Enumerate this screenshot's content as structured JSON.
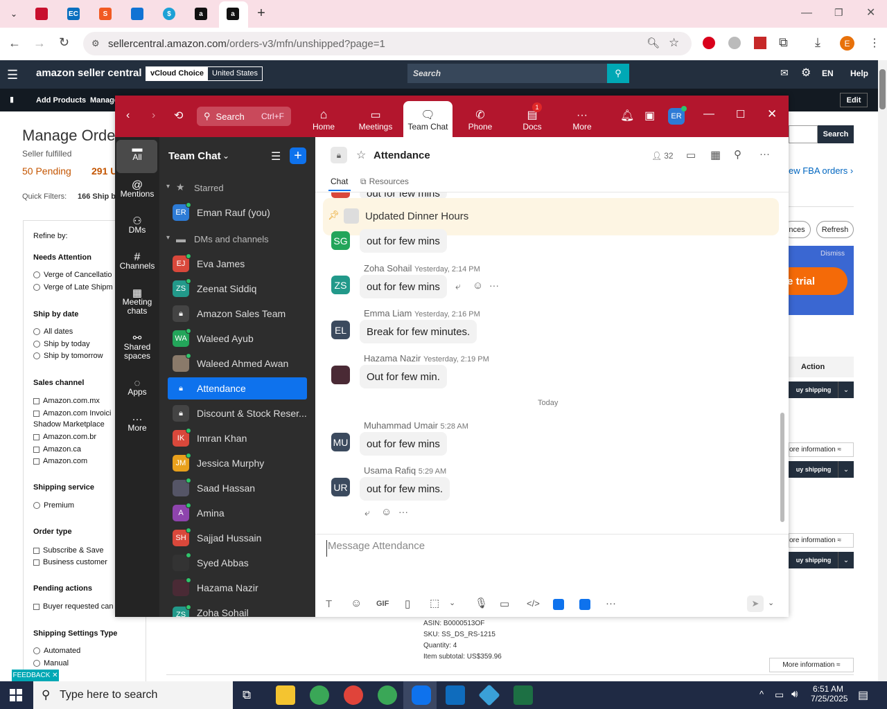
{
  "browser": {
    "url_domain": "sellercentral.amazon.com",
    "url_path": "/orders-v3/mfn/unshipped?page=1",
    "profile_initial": "E"
  },
  "seller_central": {
    "logo": "amazon seller central",
    "store_name": "vCloud Choice",
    "marketplace": "United States",
    "search_placeholder": "Search",
    "language": "EN",
    "help": "Help",
    "nav": {
      "add_products": "Add Products",
      "manage": "Manage",
      "edit": "Edit"
    },
    "page_title": "Manage Orde",
    "subtitle": "Seller fulfilled",
    "pending": "50 Pending",
    "count_291": "291 U",
    "quick_filters": "Quick Filters:",
    "quick_ship": "166 Ship b",
    "search_btn": "Search",
    "fba_link": "ew FBA orders ›",
    "ances_btn": "nces",
    "refresh_btn": "Refresh",
    "dismiss": "Dismiss",
    "trial": "e trial",
    "action_header": "Action",
    "buy_shipping": "uy shipping",
    "more_info": "ore information ≈",
    "more_info_full": "More information ≈",
    "feedback": "FEEDBACK ✕",
    "order": {
      "asin": "ASIN: B0000513OF",
      "sku": "SKU: SS_DS_RS-1215",
      "quantity": "Quantity: 4",
      "subtotal": "Item subtotal: US$359.96"
    },
    "refine_by": "Refine by:",
    "filters": {
      "needs_attention": "Needs Attention",
      "na1": "Verge of Cancellatio",
      "na2": "Verge of Late Shipm",
      "ship_by_date": "Ship by date",
      "sd1": "All dates",
      "sd2": "Ship by today",
      "sd3": "Ship by tomorrow",
      "sales_channel": "Sales channel",
      "sc1": "Amazon.com.mx",
      "sc2": "Amazon.com Invoici",
      "sc2b": "Shadow Marketplace",
      "sc3": "Amazon.com.br",
      "sc4": "Amazon.ca",
      "sc5": "Amazon.com",
      "shipping_service": "Shipping service",
      "ss1": "Premium",
      "order_type": "Order type",
      "ot1": "Subscribe & Save",
      "ot2": "Business customer",
      "pending_actions": "Pending actions",
      "pa1": "Buyer requested can",
      "shipping_settings": "Shipping Settings Type",
      "st1": "Automated",
      "st2": "Manual"
    }
  },
  "zoom": {
    "search": "Search",
    "search_shortcut": "Ctrl+F",
    "nav": {
      "home": "Home",
      "meetings": "Meetings",
      "team_chat": "Team Chat",
      "phone": "Phone",
      "docs": "Docs",
      "docs_badge": "1",
      "more": "More"
    },
    "user_initials": "ER",
    "left_nav": {
      "all": "All",
      "mentions": "Mentions",
      "dms": "DMs",
      "channels": "Channels",
      "meeting_chats_1": "Meeting",
      "meeting_chats_2": "chats",
      "shared_1": "Shared",
      "shared_2": "spaces",
      "apps": "Apps",
      "more": "More"
    },
    "list_title": "Team Chat",
    "starred": "Starred",
    "dms_channels": "DMs and channels",
    "contacts": [
      {
        "initials": "ER",
        "name": "Eman Rauf (you)"
      },
      {
        "initials": "EJ",
        "name": "Eva James"
      },
      {
        "initials": "ZS",
        "name": "Zeenat Siddiq"
      },
      {
        "initials": "",
        "name": "Amazon Sales Team"
      },
      {
        "initials": "WA",
        "name": "Waleed Ayub"
      },
      {
        "initials": "",
        "name": "Waleed Ahmed Awan"
      },
      {
        "initials": "",
        "name": "Attendance"
      },
      {
        "initials": "",
        "name": "Discount & Stock Reser..."
      },
      {
        "initials": "IK",
        "name": "Imran Khan"
      },
      {
        "initials": "JM",
        "name": "Jessica Murphy"
      },
      {
        "initials": "",
        "name": "Saad Hassan"
      },
      {
        "initials": "A",
        "name": "Amina"
      },
      {
        "initials": "SH",
        "name": "Sajjad Hussain"
      },
      {
        "initials": "",
        "name": "Syed Abbas"
      },
      {
        "initials": "",
        "name": "Hazama Nazir"
      },
      {
        "initials": "ZS",
        "name": "Zoha Sohail"
      }
    ],
    "channel": {
      "name": "Attendance",
      "member_count": "32",
      "tab_chat": "Chat",
      "tab_resources": "Resources",
      "pinned": "Updated Dinner Hours",
      "top_partial": "out for few mins",
      "today": "Today",
      "composer_placeholder": "Message Attendance",
      "gif": "GIF"
    },
    "messages": [
      {
        "initials": "SG",
        "name": "",
        "time": "",
        "text": "out for few mins"
      },
      {
        "initials": "ZS",
        "name": "Zoha Sohail",
        "time": "Yesterday, 2:14 PM",
        "text": "out for few mins"
      },
      {
        "initials": "EL",
        "name": "Emma Liam",
        "time": "Yesterday, 2:16 PM",
        "text": "Break for few minutes."
      },
      {
        "initials": "",
        "name": "Hazama Nazir",
        "time": "Yesterday, 2:19 PM",
        "text": "Out for few min."
      },
      {
        "initials": "MU",
        "name": "Muhammad Umair",
        "time": "5:28 AM",
        "text": "out for few mins"
      },
      {
        "initials": "UR",
        "name": "Usama Rafiq",
        "time": "5:29 AM",
        "text": "out for few mins."
      }
    ]
  },
  "taskbar": {
    "search_placeholder": "Type here to search",
    "time": "6:51 AM",
    "date": "7/25/2025"
  },
  "colors": {
    "zoom_red": "#b3162d",
    "accent_blue": "#0e72ed",
    "amazon_dark": "#232f3e",
    "online": "#2fc46b"
  }
}
